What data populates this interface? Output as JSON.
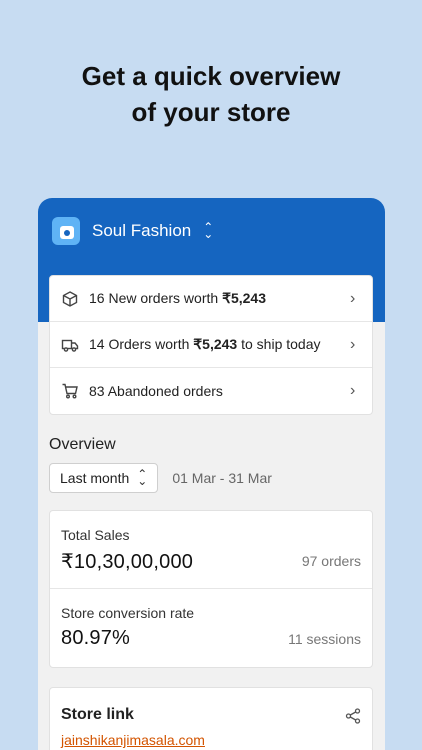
{
  "headline": {
    "line1": "Get a quick overview",
    "line2": "of your store"
  },
  "store": {
    "name": "Soul Fashion"
  },
  "alerts": [
    {
      "icon": "box-icon",
      "prefix": "16 New orders worth ",
      "amount": "₹5,243",
      "suffix": ""
    },
    {
      "icon": "truck-icon",
      "prefix": "14 Orders worth ",
      "amount": "₹5,243",
      "suffix": " to ship today"
    },
    {
      "icon": "cart-icon",
      "prefix": "83 Abandoned orders",
      "amount": "",
      "suffix": ""
    }
  ],
  "overview": {
    "title": "Overview",
    "period": "Last month",
    "date_range": "01 Mar - 31 Mar"
  },
  "stats": [
    {
      "label": "Total Sales",
      "value": "₹10,30,00,000",
      "side": "97 orders"
    },
    {
      "label": "Store conversion rate",
      "value": "80.97%",
      "side": "11 sessions"
    }
  ],
  "store_link": {
    "title": "Store link",
    "url": "jainshikanjimasala.com"
  },
  "colors": {
    "accent": "#1565c0",
    "background": "#c7dcf2",
    "link": "#d35400"
  }
}
